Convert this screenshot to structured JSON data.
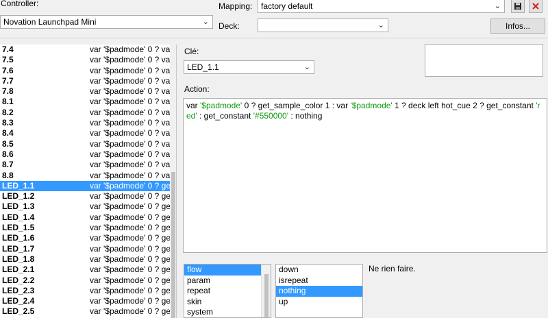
{
  "header": {
    "controller_label": "Controller:",
    "controller_value": "Novation Launchpad Mini",
    "mapping_label": "Mapping:",
    "mapping_value": "factory default",
    "deck_label": "Deck:",
    "deck_value": "",
    "infos_button": "Infos..."
  },
  "mappings": [
    {
      "key": "7.4",
      "value": "var '$padmode' 0 ? va"
    },
    {
      "key": "7.5",
      "value": "var '$padmode' 0 ? va"
    },
    {
      "key": "7.6",
      "value": "var '$padmode' 0 ? va"
    },
    {
      "key": "7.7",
      "value": "var '$padmode' 0 ? va"
    },
    {
      "key": "7.8",
      "value": "var '$padmode' 0 ? va"
    },
    {
      "key": "8.1",
      "value": "var '$padmode' 0 ? va"
    },
    {
      "key": "8.2",
      "value": "var '$padmode' 0 ? va"
    },
    {
      "key": "8.3",
      "value": "var '$padmode' 0 ? va"
    },
    {
      "key": "8.4",
      "value": "var '$padmode' 0 ? va"
    },
    {
      "key": "8.5",
      "value": "var '$padmode' 0 ? va"
    },
    {
      "key": "8.6",
      "value": "var '$padmode' 0 ? va"
    },
    {
      "key": "8.7",
      "value": "var '$padmode' 0 ? va"
    },
    {
      "key": "8.8",
      "value": "var '$padmode' 0 ? va"
    },
    {
      "key": "LED_1.1",
      "value": "var '$padmode' 0 ? ge"
    },
    {
      "key": "LED_1.2",
      "value": "var '$padmode' 0 ? ge"
    },
    {
      "key": "LED_1.3",
      "value": "var '$padmode' 0 ? ge"
    },
    {
      "key": "LED_1.4",
      "value": "var '$padmode' 0 ? ge"
    },
    {
      "key": "LED_1.5",
      "value": "var '$padmode' 0 ? ge"
    },
    {
      "key": "LED_1.6",
      "value": "var '$padmode' 0 ? ge"
    },
    {
      "key": "LED_1.7",
      "value": "var '$padmode' 0 ? ge"
    },
    {
      "key": "LED_1.8",
      "value": "var '$padmode' 0 ? ge"
    },
    {
      "key": "LED_2.1",
      "value": "var '$padmode' 0 ? ge"
    },
    {
      "key": "LED_2.2",
      "value": "var '$padmode' 0 ? ge"
    },
    {
      "key": "LED_2.3",
      "value": "var '$padmode' 0 ? ge"
    },
    {
      "key": "LED_2.4",
      "value": "var '$padmode' 0 ? ge"
    },
    {
      "key": "LED_2.5",
      "value": "var '$padmode' 0 ? ge"
    }
  ],
  "editor": {
    "cle_label": "Clé:",
    "cle_value": "LED_1.1",
    "action_label": "Action:",
    "action_parts": [
      {
        "text": "var ",
        "str": false
      },
      {
        "text": "'$padmode'",
        "str": true
      },
      {
        "text": " 0 ? get_sample_color 1 : var ",
        "str": false
      },
      {
        "text": "'$padmode'",
        "str": true
      },
      {
        "text": " 1 ? deck left hot_cue 2 ? get_constant ",
        "str": false
      },
      {
        "text": "'red'",
        "str": true
      },
      {
        "text": " : get_constant ",
        "str": false
      },
      {
        "text": "'#550000'",
        "str": true
      },
      {
        "text": " : nothing",
        "str": false
      }
    ]
  },
  "categories": [
    "flow",
    "param",
    "repeat",
    "skin",
    "system"
  ],
  "commands": [
    "down",
    "isrepeat",
    "nothing",
    "up"
  ],
  "description": "Ne rien faire."
}
